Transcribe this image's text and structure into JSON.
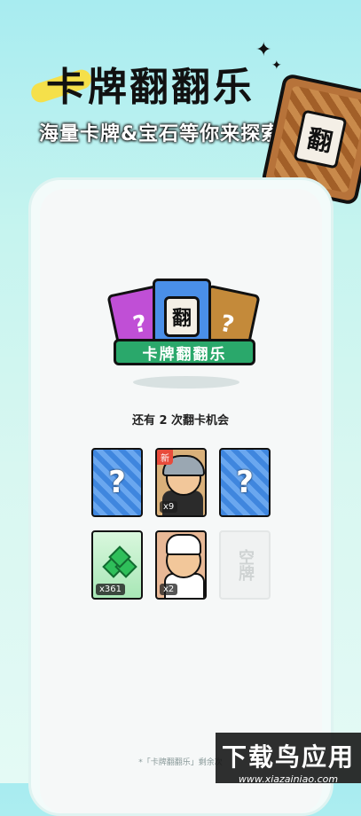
{
  "hero": {
    "title": "卡牌翻翻乐",
    "subtitle": "海量卡牌&宝石等你来探索",
    "promo_card_glyph": "翻"
  },
  "logo": {
    "card_glyph": "翻",
    "banner": "卡牌翻翻乐"
  },
  "status": {
    "chances_text": "还有 2 次翻卡机会"
  },
  "cards": [
    {
      "type": "back",
      "label": "?"
    },
    {
      "type": "character",
      "badge": "新",
      "count": "x9"
    },
    {
      "type": "back",
      "label": "?"
    },
    {
      "type": "gem",
      "count": "x361"
    },
    {
      "type": "character",
      "count": "x2"
    },
    {
      "type": "empty",
      "label": "空牌"
    }
  ],
  "footer": {
    "note": "*「卡牌翻翻乐」剩余次"
  },
  "watermark": {
    "title": "下载鸟应用",
    "url": "www.xiazainiao.com"
  },
  "colors": {
    "background_top": "#a8ecf0",
    "banner_green": "#2aa86b",
    "card_blue": "#3f86de",
    "badge_red": "#e84b3b"
  }
}
